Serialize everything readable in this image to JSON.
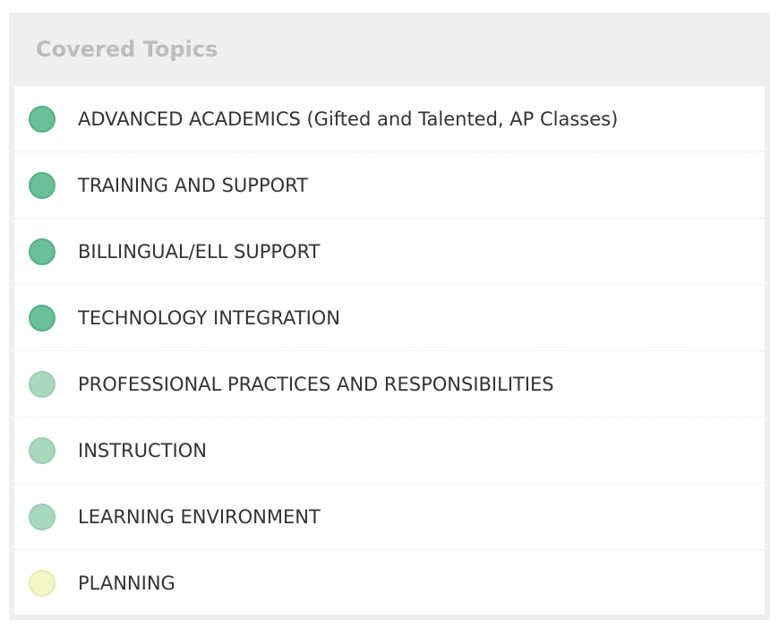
{
  "panel": {
    "title": "Covered Topics"
  },
  "colors": {
    "level_high": "#6bbf98",
    "level_mid": "#a9d8bd",
    "level_low": "#f3f7c7"
  },
  "topics": [
    {
      "label": "ADVANCED ACADEMICS (Gifted and Talented, AP Classes)",
      "level": "high"
    },
    {
      "label": "TRAINING AND SUPPORT",
      "level": "high"
    },
    {
      "label": "BILLINGUAL/ELL SUPPORT",
      "level": "high"
    },
    {
      "label": "TECHNOLOGY INTEGRATION",
      "level": "high"
    },
    {
      "label": "PROFESSIONAL PRACTICES AND RESPONSIBILITIES",
      "level": "mid"
    },
    {
      "label": "INSTRUCTION",
      "level": "mid"
    },
    {
      "label": "LEARNING ENVIRONMENT",
      "level": "mid"
    },
    {
      "label": "PLANNING",
      "level": "low"
    }
  ]
}
